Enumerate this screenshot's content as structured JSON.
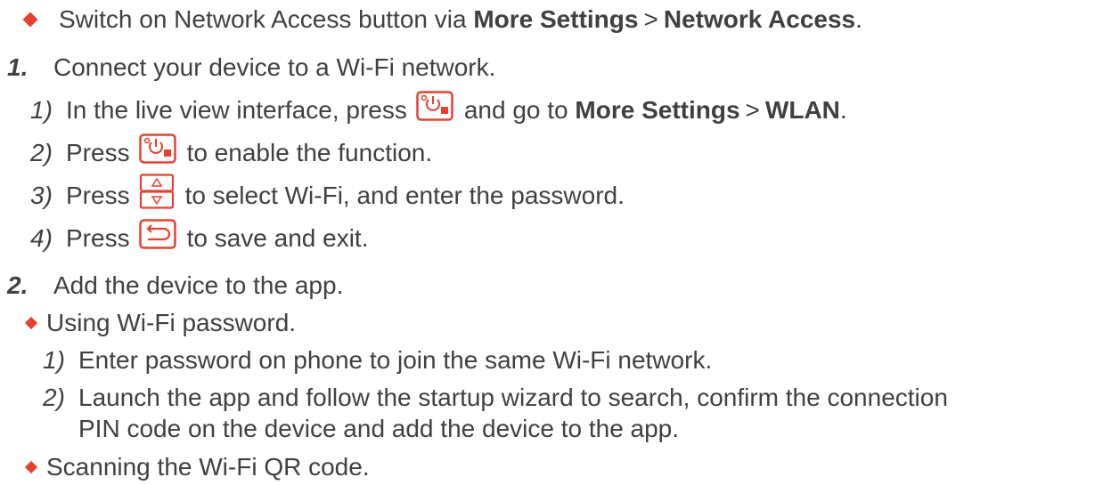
{
  "bullet_intro": {
    "text_before": "Switch on Network Access button via ",
    "bold1": "More Settings",
    "sep": ">",
    "bold2": "Network Access",
    "end": "."
  },
  "step1": {
    "number": "1.",
    "text": "Connect your device to a Wi-Fi network.",
    "substeps": {
      "s1": {
        "number": "1)",
        "text_before": "In the live view interface, press",
        "text_after": "and go to ",
        "bold1": "More Settings",
        "sep": ">",
        "bold2": "WLAN",
        "end": "."
      },
      "s2": {
        "number": "2)",
        "text_before": "Press",
        "text_after": "to enable the function."
      },
      "s3": {
        "number": "3)",
        "text_before": "Press",
        "text_after": "to select Wi-Fi, and enter the password."
      },
      "s4": {
        "number": "4)",
        "text_before": "Press",
        "text_after": "to save and exit."
      }
    }
  },
  "step2": {
    "number": "2.",
    "text": "Add the device to the app.",
    "option1": {
      "text": "Using Wi-Fi password.",
      "s1": {
        "number": "1)",
        "text": "Enter password on phone to join the same Wi-Fi network."
      },
      "s2": {
        "number": "2)",
        "text_line1": "Launch the app and follow the startup wizard to search, confirm the connection",
        "text_line2": "PIN code on the device and add the device to the app."
      }
    },
    "option2": {
      "text": "Scanning the Wi-Fi QR code."
    }
  },
  "colors": {
    "accent": "#e8402f",
    "text": "#404040"
  },
  "icons": [
    "power-menu-key-icon",
    "up-down-key-icon",
    "back-key-icon"
  ]
}
